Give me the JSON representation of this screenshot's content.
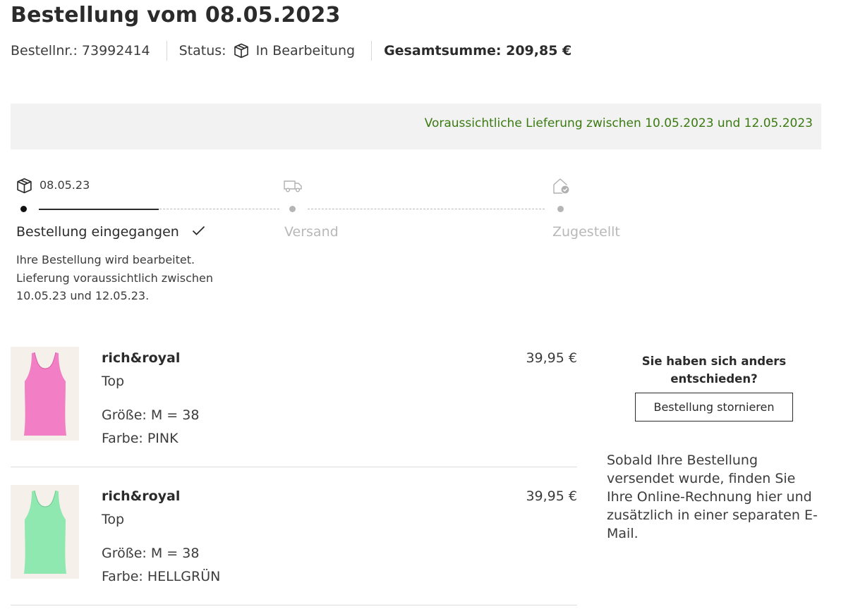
{
  "order": {
    "title": "Bestellung vom 08.05.2023",
    "number_label": "Bestellnr.: 73992414",
    "status_label": "Status:",
    "status_value": "In Bearbeitung",
    "total_label": "Gesamtsumme: 209,85 €"
  },
  "delivery_banner": "Voraussichtliche Lieferung zwischen 10.05.2023 und 12.05.2023",
  "tracker": {
    "date": "08.05.23",
    "steps": [
      {
        "label": "Bestellung eingegangen",
        "state": "done",
        "icon": "package-icon"
      },
      {
        "label": "Versand",
        "state": "pending",
        "icon": "truck-icon"
      },
      {
        "label": "Zugestellt",
        "state": "pending",
        "icon": "delivered-house-icon"
      }
    ],
    "description": "Ihre Bestellung wird bearbeitet. Lieferung voraussichtlich zwischen 10.05.23 und 12.05.23."
  },
  "items": [
    {
      "brand": "rich&royal",
      "type": "Top",
      "size": "Größe: M = 38",
      "color": "Farbe: PINK",
      "price": "39,95 €",
      "swatch": "#f27ec6"
    },
    {
      "brand": "rich&royal",
      "type": "Top",
      "size": "Größe: M = 38",
      "color": "Farbe: HELLGRÜN",
      "price": "39,95 €",
      "swatch": "#8fe8b0"
    }
  ],
  "cancel": {
    "question": "Sie haben sich anders entschieden?",
    "button": "Bestellung stornieren"
  },
  "invoice_note": "Sobald Ihre Bestellung versendet wurde, finden Sie Ihre Online-Rechnung hier und zusätzlich in einer separaten E-Mail.",
  "colors": {
    "text": "#2b2b2b",
    "delivery_green": "#3a7a10",
    "banner_bg": "#f2f2f2",
    "inactive": "#b8b8b8"
  }
}
